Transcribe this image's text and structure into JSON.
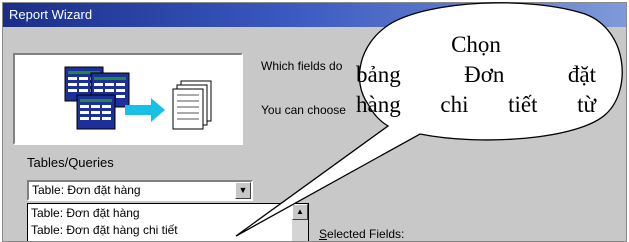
{
  "window": {
    "title": "Report Wizard"
  },
  "prompt": {
    "line1": "Which fields do",
    "line2": "You can choose"
  },
  "tables": {
    "label": "Tables/Queries",
    "selected_value": "Table: Đơn đặt hàng",
    "options": [
      "Table: Đơn đặt hàng",
      "Table: Đơn đặt hàng chi tiết"
    ]
  },
  "fields": {
    "selected_label_underlined": "S",
    "selected_label_rest": "elected Fields:"
  },
  "callout": {
    "line1": "Chọn",
    "line2": "bảng Đơn đặt",
    "line3": "hàng chi tiết từ"
  },
  "colors": {
    "titlebar_start": "#1a2e88",
    "titlebar_end": "#7e9ad8",
    "dialog_face": "#c8c8c8",
    "table_icon_blue": "#1c2f9a",
    "table_icon_green": "#1e8a3a",
    "arrow_cyan": "#19c0e6"
  }
}
